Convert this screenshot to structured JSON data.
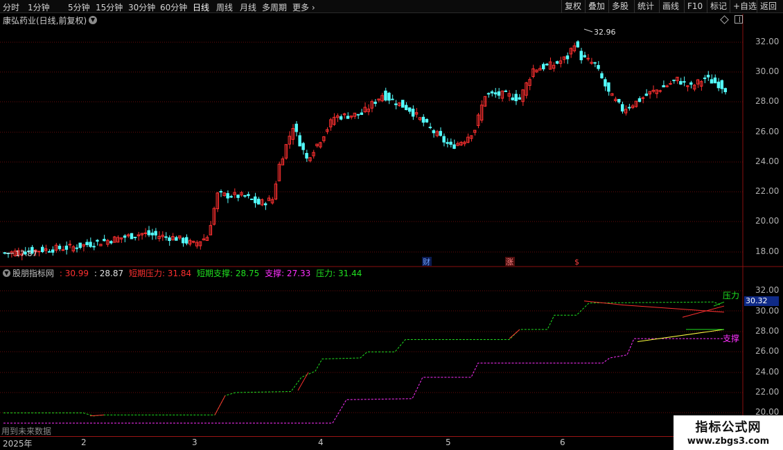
{
  "toolbar": {
    "tabs": [
      "分时",
      "1分钟",
      "5分钟",
      "15分钟",
      "30分钟",
      "60分钟",
      "日线",
      "周线",
      "月线",
      "多周期",
      "更多"
    ],
    "active": "日线",
    "right_buttons": [
      "复权",
      "叠加",
      "多股",
      "统计",
      "画线",
      "F10",
      "标记",
      "+自选",
      "返回"
    ]
  },
  "price_panel": {
    "title": "康弘药业(日线,前复权)",
    "axis": [
      "32.00",
      "30.00",
      "28.00",
      "26.00",
      "24.00",
      "22.00",
      "20.00",
      "18.00"
    ],
    "high_label": "32.96",
    "low_label": "17.87",
    "markers": [
      "财",
      "涨",
      "$"
    ]
  },
  "indicator": {
    "name": "股朋指标网",
    "val1": ": 30.99",
    "val2": ": 28.87",
    "v3_label": "短期压力",
    "v3": ": 31.84",
    "v4_label": "短期支撑",
    "v4": ": 28.75",
    "v5_label": "支撑",
    "v5": ": 27.33",
    "v6_label": "压力",
    "v6": ": 31.44",
    "axis": [
      "32.00",
      "30.00",
      "28.00",
      "26.00",
      "24.00",
      "22.00",
      "20.00"
    ],
    "right_label_pressure": "压力",
    "right_label_support": "支撑",
    "current_price": "30.32"
  },
  "future_label": "用到未来数据",
  "date_axis": [
    "2025年",
    "2",
    "3",
    "4",
    "5",
    "6"
  ],
  "watermark": {
    "title": "指标公式网",
    "url": "www.zbgs3.com"
  },
  "colors": {
    "up": "#ff3030",
    "down": "#54ffff",
    "green": "#20e020",
    "magenta": "#ff30ff",
    "yellow": "#ffff40",
    "grid": "#7a1010"
  }
}
